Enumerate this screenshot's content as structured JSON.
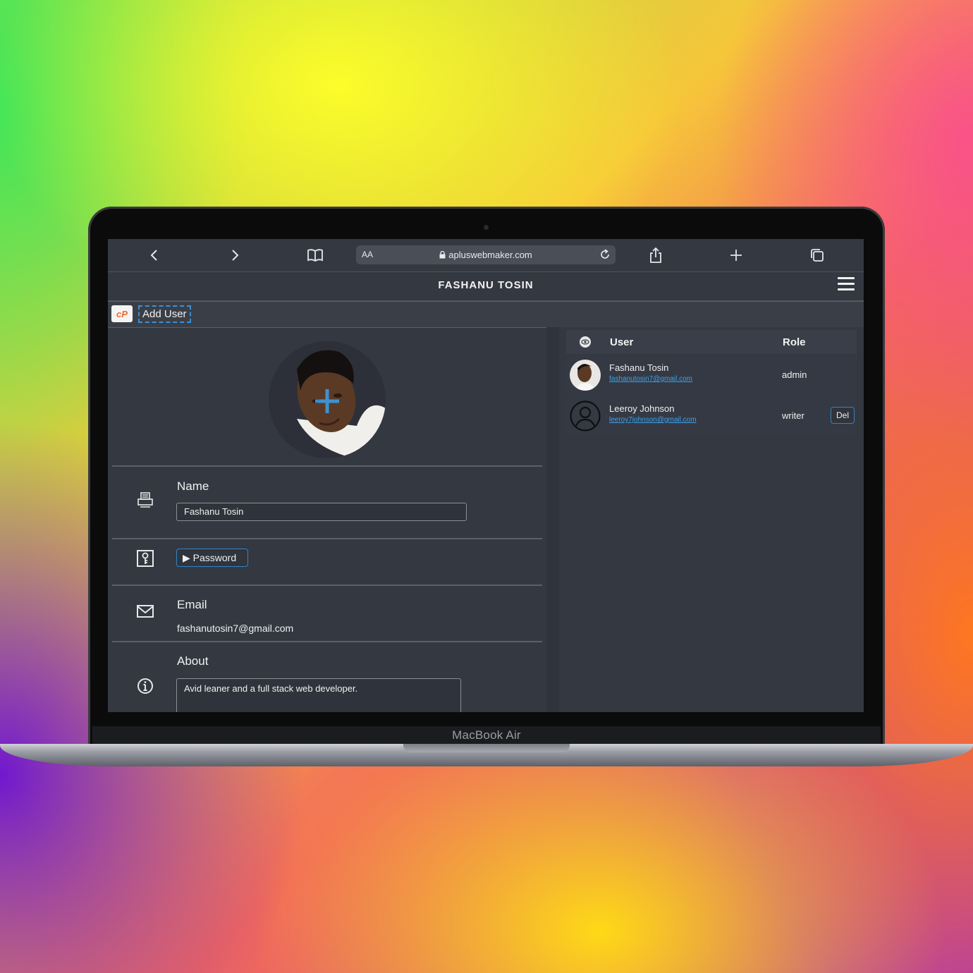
{
  "device": {
    "label": "MacBook Air"
  },
  "browser": {
    "aa_label": "AA",
    "url": "apluswebmaker.com"
  },
  "site": {
    "title": "FASHANU TOSIN",
    "logo_text": "cP",
    "add_user_label": "Add User"
  },
  "profile": {
    "name_label": "Name",
    "name_value": "Fashanu Tosin",
    "password_label": "▶ Password",
    "email_label": "Email",
    "email_value": "fashanutosin7@gmail.com",
    "about_label": "About",
    "about_value": "Avid leaner and a full stack web developer."
  },
  "users_table": {
    "headers": {
      "user": "User",
      "role": "Role"
    },
    "rows": [
      {
        "name": "Fashanu Tosin",
        "email": "fashanutosin7@gmail.com",
        "role": "admin",
        "action": ""
      },
      {
        "name": "Leeroy Johnson",
        "email": "leeroy7johnson@gmail.com",
        "role": "writer",
        "action": "Del"
      }
    ]
  },
  "colors": {
    "screen_bg": "#343841",
    "accent_blue": "#2f86c6",
    "link_blue": "#3aa3ef",
    "cpanel_orange": "#ef6a2a"
  }
}
